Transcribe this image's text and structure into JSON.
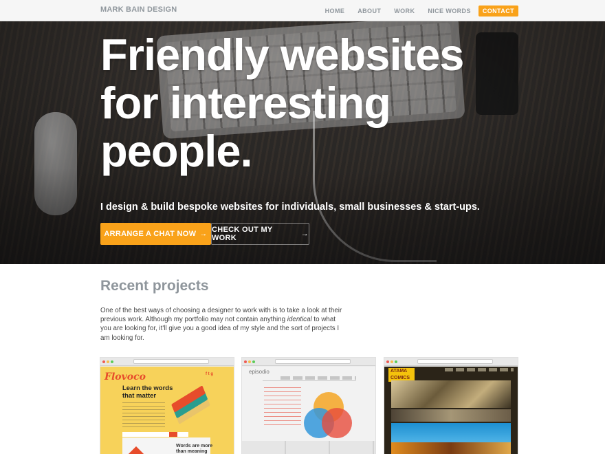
{
  "brand": "MARK BAIN DESIGN",
  "nav": {
    "home": "HOME",
    "about": "ABOUT",
    "work": "WORK",
    "nice_words": "NICE WORDS",
    "contact": "CONTACT"
  },
  "hero": {
    "headline_line1": "Friendly websites",
    "headline_line2": "for interesting",
    "headline_line3": "people.",
    "tagline": "I design & build bespoke websites for individuals, small businesses & start-ups.",
    "primary_button": "ARRANGE A CHAT NOW",
    "secondary_button": "CHECK OUT MY WORK",
    "arrow": "→"
  },
  "projects": {
    "title": "Recent projects",
    "intro_before": "One of the best ways of choosing a designer to work with is to take a look at their previous work. Although my portfolio may not contain anything ",
    "intro_em": "identical",
    "intro_after": " to what you are looking for, it'll give you a good idea of my style and the sort of projects I am looking for.",
    "cards": [
      {
        "logo": "Flovoco",
        "headline": "Learn the words that matter",
        "subhead": "Words are more than meaning"
      },
      {
        "logo": "episodio"
      },
      {
        "logo": "ATAMA COMICS"
      }
    ]
  },
  "colors": {
    "accent": "#f9a21a",
    "nav_text": "#8f969c",
    "heading_gray": "#8f969c"
  }
}
